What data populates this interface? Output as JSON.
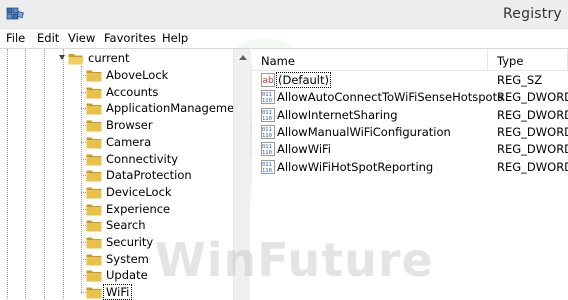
{
  "window": {
    "title": "Registry Ed"
  },
  "menu": [
    "File",
    "Edit",
    "View",
    "Favorites",
    "Help"
  ],
  "tree": {
    "parent": "current",
    "children": [
      "AboveLock",
      "Accounts",
      "ApplicationManagement",
      "Browser",
      "Camera",
      "Connectivity",
      "DataProtection",
      "DeviceLock",
      "Experience",
      "Search",
      "Security",
      "System",
      "Update",
      "WiFi"
    ],
    "selected": "WiFi"
  },
  "list": {
    "columns": {
      "name": "Name",
      "type": "Type"
    },
    "rows": [
      {
        "name": "(Default)",
        "type": "REG_SZ",
        "icon": "string-value-icon"
      },
      {
        "name": "AllowAutoConnectToWiFiSenseHotspots",
        "type": "REG_DWORD",
        "icon": "dword-value-icon"
      },
      {
        "name": "AllowInternetSharing",
        "type": "REG_DWORD",
        "icon": "dword-value-icon"
      },
      {
        "name": "AllowManualWiFiConfiguration",
        "type": "REG_DWORD",
        "icon": "dword-value-icon"
      },
      {
        "name": "AllowWiFi",
        "type": "REG_DWORD",
        "icon": "dword-value-icon"
      },
      {
        "name": "AllowWiFiHotSpotReporting",
        "type": "REG_DWORD",
        "icon": "dword-value-icon"
      }
    ]
  },
  "watermark": "WinFuture",
  "colors": {
    "folder": "#e8c14a",
    "folder_dark": "#c99a26",
    "dword_icon": "#2b5faa",
    "string_icon": "#c0392b"
  }
}
